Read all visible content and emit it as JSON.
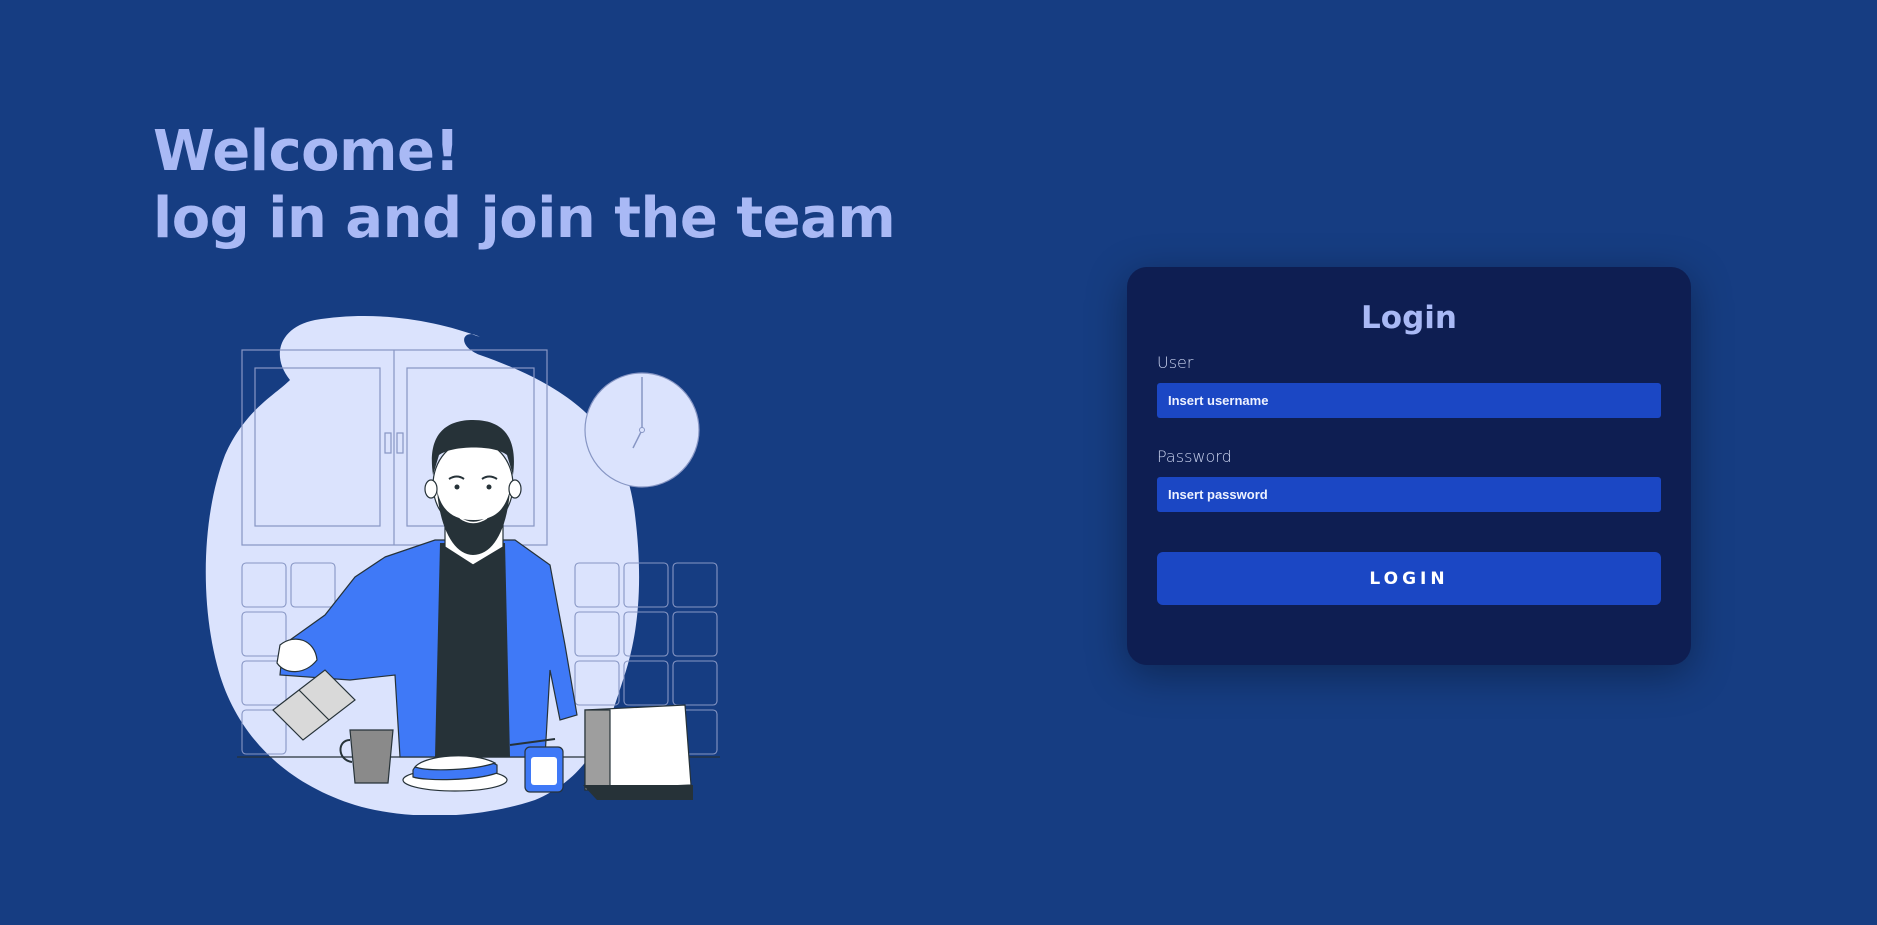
{
  "hero": {
    "line1": "Welcome!",
    "line2": "log in and join the team"
  },
  "illustration": {
    "icon": "man-making-breakfast-illustration"
  },
  "login_card": {
    "title": "Login",
    "user_label": "User",
    "user_placeholder": "Insert username",
    "user_value": "",
    "password_label": "Password",
    "password_placeholder": "Insert password",
    "password_value": "",
    "button_label": "LOGIN"
  },
  "colors": {
    "background": "#163d82",
    "card": "#0e1e52",
    "accent": "#1b47c4",
    "heading": "#a9b9f5",
    "shirt": "#3f79f7",
    "blob": "#dbe3fd"
  }
}
